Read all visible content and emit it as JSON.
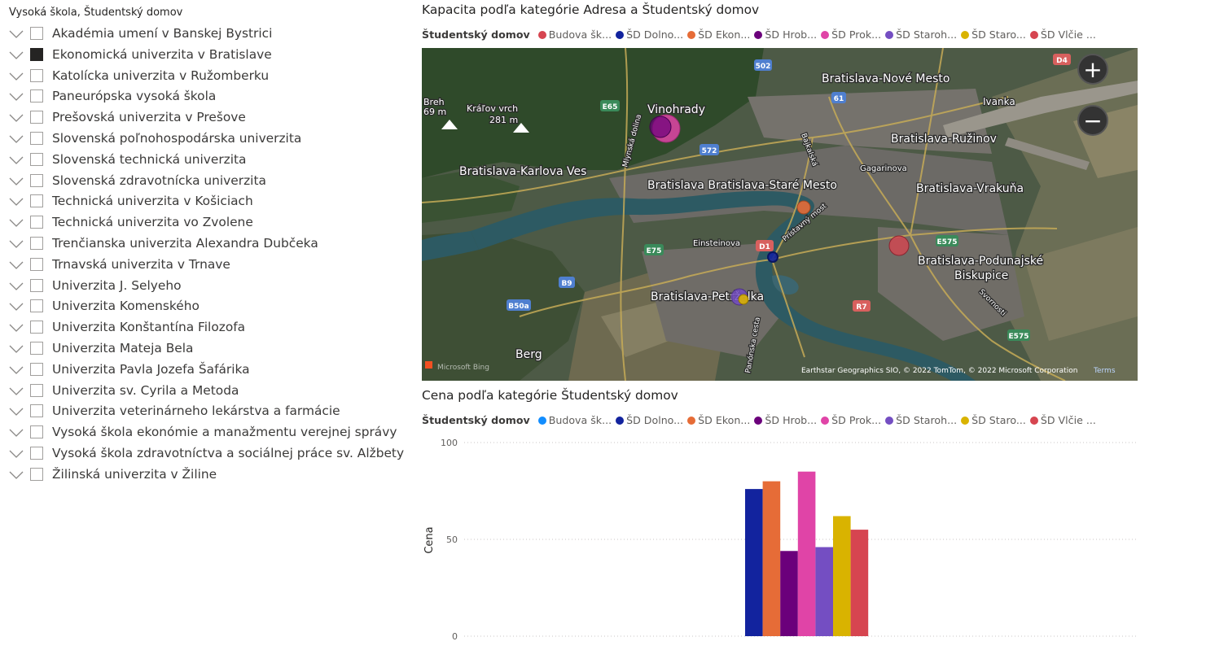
{
  "slicer": {
    "title": "Vysoká škola, Študentský domov",
    "items": [
      {
        "label": "Akadémia umení v Banskej Bystrici",
        "checked": false
      },
      {
        "label": "Ekonomická univerzita v Bratislave",
        "checked": true
      },
      {
        "label": "Katolícka univerzita v Ružomberku",
        "checked": false
      },
      {
        "label": "Paneurópska vysoká škola",
        "checked": false
      },
      {
        "label": "Prešovská univerzita v Prešove",
        "checked": false
      },
      {
        "label": "Slovenská poľnohospodárska univerzita",
        "checked": false
      },
      {
        "label": "Slovenská technická univerzita",
        "checked": false
      },
      {
        "label": "Slovenská zdravotnícka univerzita",
        "checked": false
      },
      {
        "label": "Technická univerzita v Košiciach",
        "checked": false
      },
      {
        "label": "Technická univerzita vo Zvolene",
        "checked": false
      },
      {
        "label": "Trenčianska univerzita Alexandra Dubčeka",
        "checked": false
      },
      {
        "label": "Trnavská univerzita v Trnave",
        "checked": false
      },
      {
        "label": "Univerzita J. Selyeho",
        "checked": false
      },
      {
        "label": "Univerzita Komenského",
        "checked": false
      },
      {
        "label": "Univerzita Konštantína Filozofa",
        "checked": false
      },
      {
        "label": "Univerzita Mateja Bela",
        "checked": false
      },
      {
        "label": "Univerzita Pavla Jozefa Šafárika",
        "checked": false
      },
      {
        "label": "Univerzita sv. Cyrila a Metoda",
        "checked": false
      },
      {
        "label": "Univerzita veterinárneho lekárstva a farmácie",
        "checked": false
      },
      {
        "label": "Vysoká škola ekonómie a manažmentu verejnej správy",
        "checked": false
      },
      {
        "label": "Vysoká škola zdravotníctva a sociálnej práce sv. Alžbety",
        "checked": false
      },
      {
        "label": "Žilinská univerzita v Žiline",
        "checked": false
      }
    ]
  },
  "map_visual": {
    "title": "Kapacita podľa kategórie Adresa a Študentský domov",
    "legend_title": "Študentský domov",
    "legend": [
      {
        "label": "Budova šk...",
        "color": "#D64550"
      },
      {
        "label": "ŠD Dolno...",
        "color": "#12239E"
      },
      {
        "label": "ŠD Ekon...",
        "color": "#E66C37"
      },
      {
        "label": "ŠD Hrob...",
        "color": "#6B007B"
      },
      {
        "label": "ŠD Prok...",
        "color": "#E044A7"
      },
      {
        "label": "ŠD Staroh...",
        "color": "#744EC2"
      },
      {
        "label": "ŠD Staro...",
        "color": "#D9B300"
      },
      {
        "label": "ŠD Vlčie ...",
        "color": "#D64550"
      }
    ],
    "places": {
      "vinohrady": "Vinohrady",
      "nove_mesto": "Bratislava-Nové Mesto",
      "ruzinov": "Bratislava-Ružinov",
      "karlova_ves": "Bratislava-Karlova Ves",
      "stare_mesto": "Bratislava  Bratislava-Staré Mesto",
      "vrakuna": "Bratislava-Vrakuňa",
      "podunajske": "Bratislava-Podunajské",
      "biskupice": "Biskupice",
      "petrzalka": "Bratislava-Petržalka",
      "berg": "Berg",
      "ivanka": "Ivanka",
      "kralov_vrch": "Kráľov vrch",
      "kralov_vrch_elev": "281 m",
      "breh": "Breh",
      "breh_elev": "69 m",
      "gagarinova": "Gagarinova",
      "einsteinova": "Einsteinova",
      "bajkalska": "Bajkalská",
      "mlynska": "Mlynská dolina",
      "pristavny": "Prístavný most",
      "svornosti": "Svornosti",
      "panonska": "Panónska cesta"
    },
    "road_shields": [
      "502",
      "E65",
      "61",
      "572",
      "D4",
      "E75",
      "D1",
      "E575",
      "B9",
      "B50a",
      "R7",
      "E575"
    ],
    "zoom_in": "+",
    "zoom_out": "−",
    "attribution": "Earthstar Geographics SIO, © 2022 TomTom, © 2022 Microsoft Corporation",
    "terms": "Terms",
    "bing_logo": "Microsoft Bing",
    "bubbles": [
      {
        "name": "ŠD Prok...",
        "color": "#E044A7"
      },
      {
        "name": "ŠD Hrob...",
        "color": "#6B007B"
      },
      {
        "name": "ŠD Ekon...",
        "color": "#E66C37"
      },
      {
        "name": "ŠD Dolno...",
        "color": "#12239E"
      },
      {
        "name": "ŠD Staroh...",
        "color": "#744EC2"
      },
      {
        "name": "ŠD Staro...",
        "color": "#D9B300"
      },
      {
        "name": "ŠD Vlčie ...",
        "color": "#D64550"
      }
    ]
  },
  "chart_data": {
    "type": "bar",
    "title": "Cena podľa kategórie Študentský domov",
    "legend_title": "Študentský domov",
    "legend": [
      {
        "label": "Budova šk...",
        "color": "#118DFF"
      },
      {
        "label": "ŠD Dolno...",
        "color": "#12239E"
      },
      {
        "label": "ŠD Ekon...",
        "color": "#E66C37"
      },
      {
        "label": "ŠD Hrob...",
        "color": "#6B007B"
      },
      {
        "label": "ŠD Prok...",
        "color": "#E044A7"
      },
      {
        "label": "ŠD Staroh...",
        "color": "#744EC2"
      },
      {
        "label": "ŠD Staro...",
        "color": "#D9B300"
      },
      {
        "label": "ŠD Vlčie ...",
        "color": "#D64550"
      }
    ],
    "ylabel": "Cena",
    "xlabel": "",
    "ylim": [
      0,
      100
    ],
    "yticks": [
      0,
      50,
      100
    ],
    "grid": true,
    "series": [
      {
        "name": "ŠD Dolno...",
        "value": 76,
        "color": "#12239E"
      },
      {
        "name": "ŠD Ekon...",
        "value": 80,
        "color": "#E66C37"
      },
      {
        "name": "ŠD Hrob...",
        "value": 44,
        "color": "#6B007B"
      },
      {
        "name": "ŠD Prok...",
        "value": 85,
        "color": "#E044A7"
      },
      {
        "name": "ŠD Staroh...",
        "value": 46,
        "color": "#744EC2"
      },
      {
        "name": "ŠD Staro...",
        "value": 62,
        "color": "#D9B300"
      },
      {
        "name": "ŠD Vlčie ...",
        "value": 55,
        "color": "#D64550"
      }
    ]
  }
}
